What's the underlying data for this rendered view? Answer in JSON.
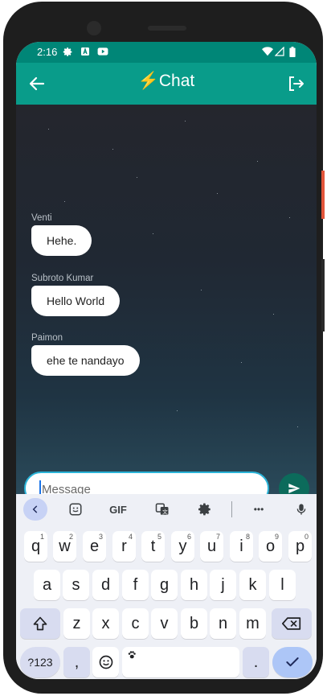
{
  "status_bar": {
    "time": "2:16"
  },
  "app_bar": {
    "title": "⚡Chat"
  },
  "messages": [
    {
      "sender": "Venti",
      "text": "Hehe."
    },
    {
      "sender": "Subroto Kumar",
      "text": "Hello World"
    },
    {
      "sender": "Paimon",
      "text": "ehe te nandayo"
    }
  ],
  "composer": {
    "placeholder": "Message"
  },
  "keyboard": {
    "toolbar": {
      "gif_label": "GIF",
      "more_label": "•••"
    },
    "row1": [
      {
        "key": "q",
        "hint": "1"
      },
      {
        "key": "w",
        "hint": "2"
      },
      {
        "key": "e",
        "hint": "3"
      },
      {
        "key": "r",
        "hint": "4"
      },
      {
        "key": "t",
        "hint": "5"
      },
      {
        "key": "y",
        "hint": "6"
      },
      {
        "key": "u",
        "hint": "7"
      },
      {
        "key": "i",
        "hint": "8"
      },
      {
        "key": "o",
        "hint": "9"
      },
      {
        "key": "p",
        "hint": "0"
      }
    ],
    "row2": [
      "a",
      "s",
      "d",
      "f",
      "g",
      "h",
      "j",
      "k",
      "l"
    ],
    "row3": [
      "z",
      "x",
      "c",
      "v",
      "b",
      "n",
      "m"
    ],
    "symbols_label": "?123",
    "comma_label": ",",
    "period_label": "."
  }
}
